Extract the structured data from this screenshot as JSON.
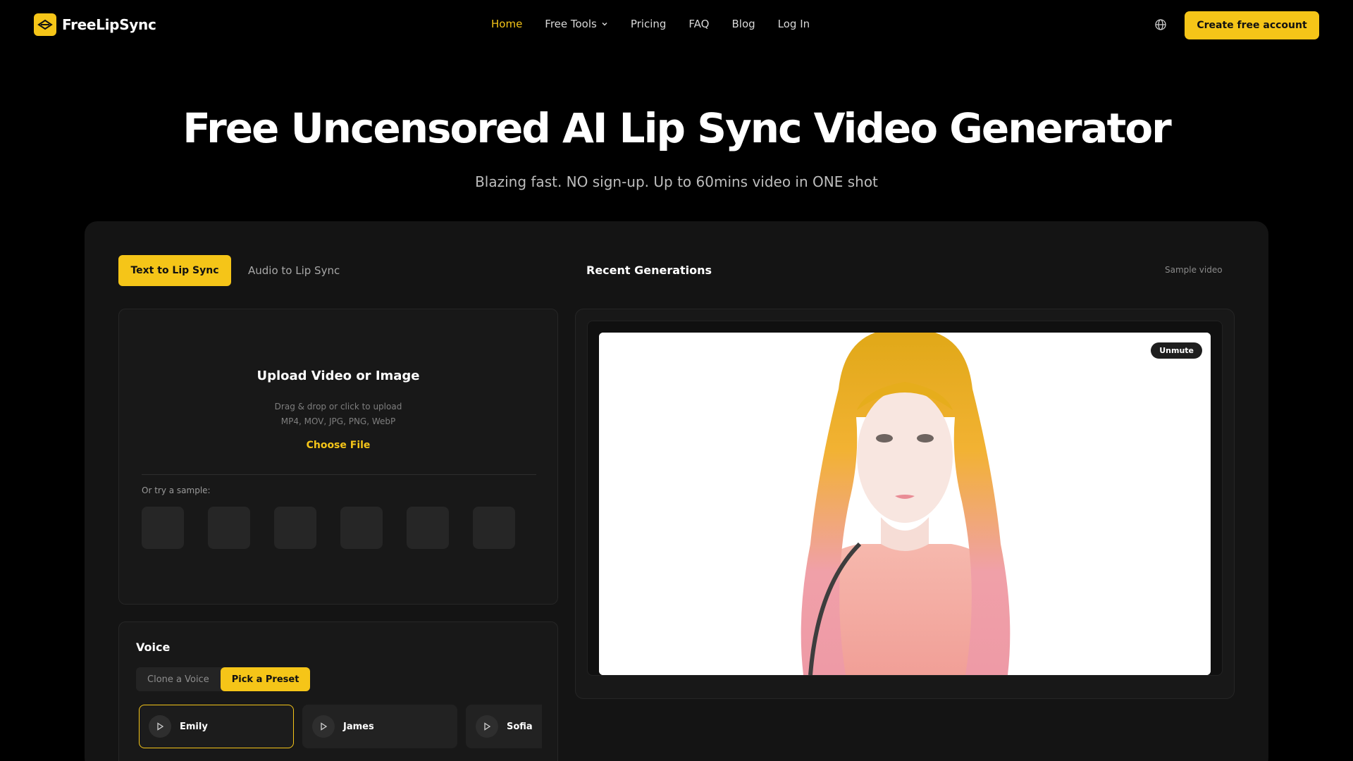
{
  "brand": {
    "name": "FreeLipSync"
  },
  "nav": {
    "items": [
      {
        "label": "Home",
        "active": true
      },
      {
        "label": "Free Tools",
        "dropdown": true
      },
      {
        "label": "Pricing"
      },
      {
        "label": "FAQ"
      },
      {
        "label": "Blog"
      },
      {
        "label": "Log In"
      }
    ],
    "cta_label": "Create free account"
  },
  "hero": {
    "title": "Free Uncensored AI Lip Sync Video Generator",
    "subtitle": "Blazing fast. NO sign-up. Up to 60mins video in ONE shot"
  },
  "tabs": {
    "active": "Text to Lip Sync",
    "inactive": "Audio to Lip Sync"
  },
  "recent": {
    "title": "Recent Generations",
    "sample_label": "Sample video",
    "unmute_label": "Unmute"
  },
  "upload": {
    "title": "Upload Video or Image",
    "hint_line1": "Drag & drop or click to upload",
    "hint_line2": "MP4, MOV, JPG, PNG, WebP",
    "choose_label": "Choose File",
    "sample_label": "Or try a sample:"
  },
  "voice": {
    "title": "Voice",
    "toggle": {
      "clone": "Clone a Voice",
      "preset": "Pick a Preset"
    },
    "presets": [
      {
        "name": "Emily",
        "selected": true
      },
      {
        "name": "James"
      },
      {
        "name": "Sofia"
      }
    ]
  },
  "colors": {
    "accent": "#f5c518",
    "background": "#000000",
    "panel": "#141414"
  }
}
